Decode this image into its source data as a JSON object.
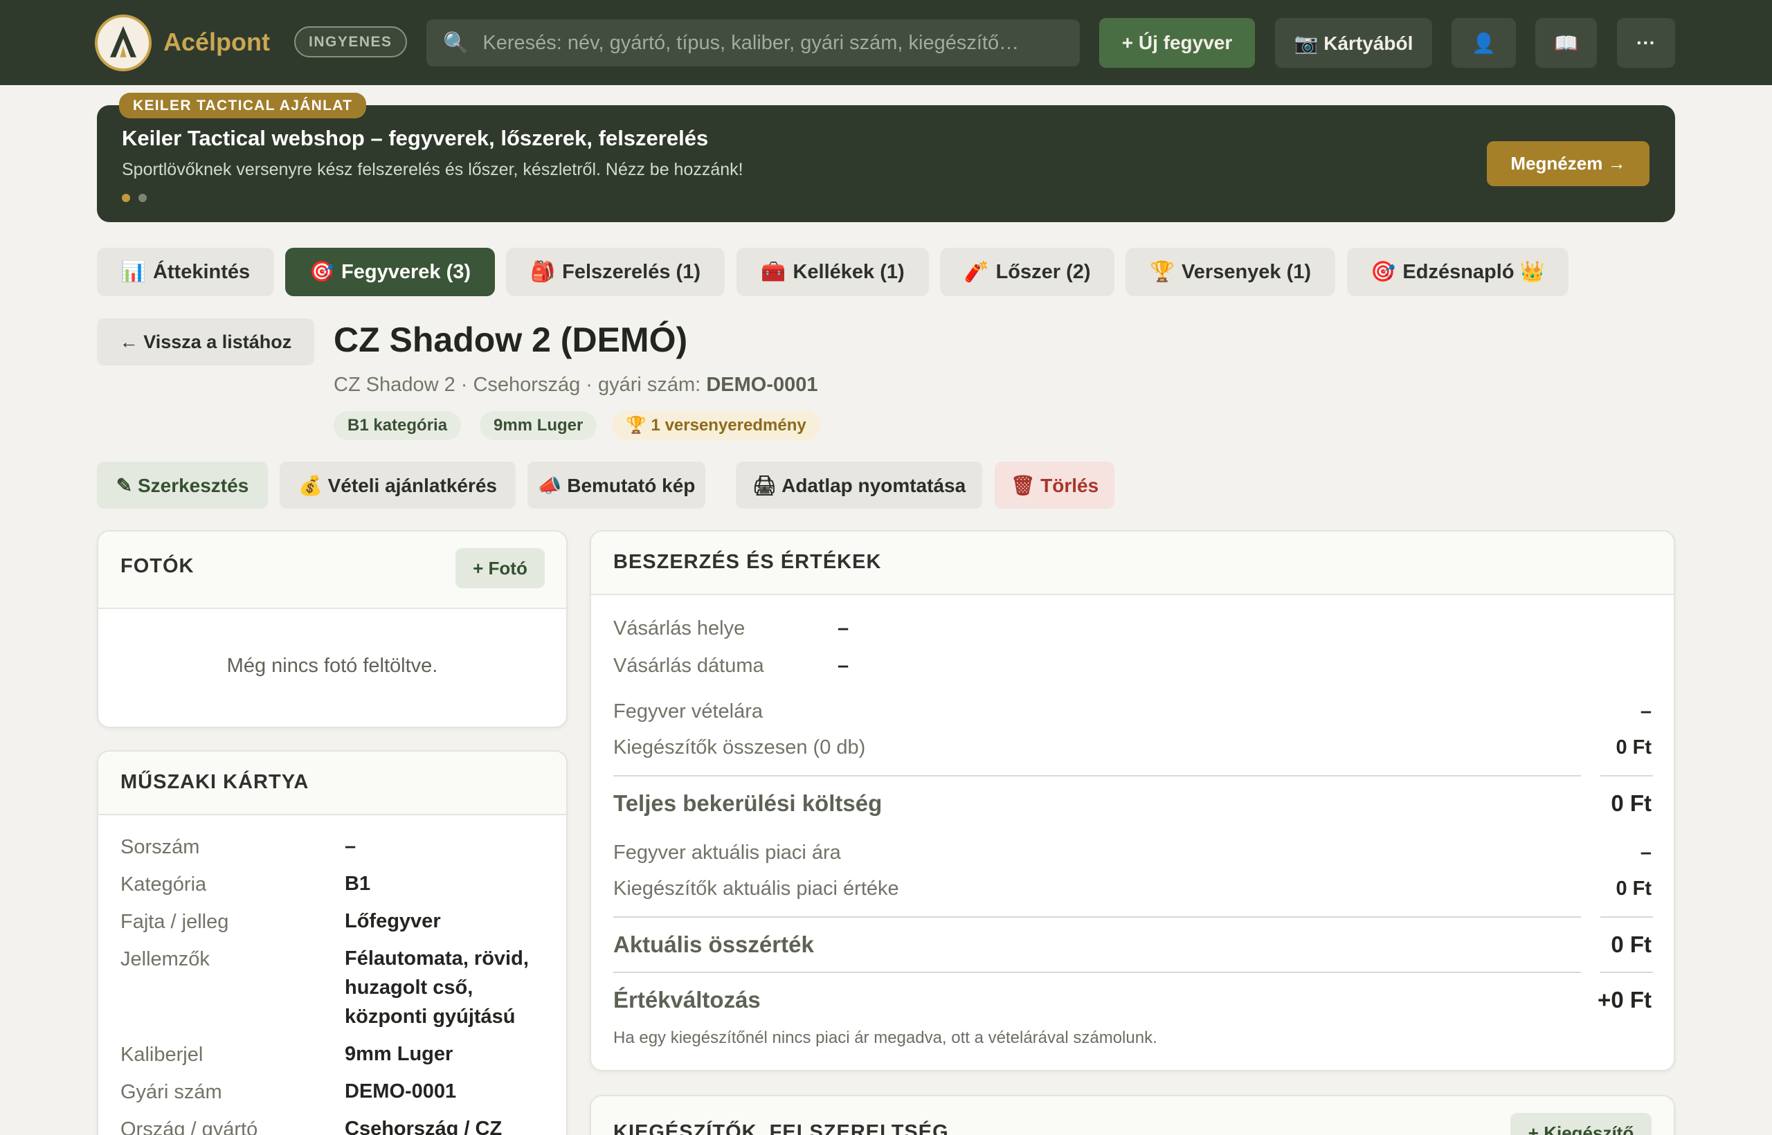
{
  "app": {
    "brand": "Acélpont",
    "plan_badge": "INGYENES",
    "search_placeholder": "Keresés: név, gyártó, típus, kaliber, gyári szám, kiegészítő…",
    "new_weapon": "+ Új fegyver",
    "from_card": "📷 Kártyából",
    "user_icon": "👤",
    "book_icon": "📖",
    "more_icon": "···"
  },
  "promo": {
    "tag": "KEILER TACTICAL AJÁNLAT",
    "title": "Keiler Tactical webshop – fegyverek, lőszerek, felszerelés",
    "subtitle": "Sportlövőknek versenyre kész felszerelés és lőszer, készletről. Nézz be hozzánk!",
    "cta": "Megnézem →"
  },
  "tabs": [
    {
      "icon": "📊",
      "label": "Áttekintés"
    },
    {
      "icon": "🎯",
      "label": "Fegyverek (3)"
    },
    {
      "icon": "🎒",
      "label": "Felszerelés (1)"
    },
    {
      "icon": "🧰",
      "label": "Kellékek (1)"
    },
    {
      "icon": "🧨",
      "label": "Lőszer (2)"
    },
    {
      "icon": "🏆",
      "label": "Versenyek (1)"
    },
    {
      "icon": "🎯",
      "label": "Edzésnapló 👑"
    }
  ],
  "detail": {
    "back": "← Vissza a listához",
    "title": "CZ Shadow 2 (DEMÓ)",
    "subtitle_prefix": "CZ Shadow 2 · Csehország · gyári szám: ",
    "serial": "DEMO-0001",
    "chips": [
      "B1 kategória",
      "9mm Luger",
      "🏆 1 versenyeredmény"
    ],
    "actions": {
      "edit": "✎ Szerkesztés",
      "offer": "💰 Vételi ajánlatkérés",
      "showcase": "📣 Bemutató kép",
      "print": "🖨 Adatlap nyomtatása",
      "delete": "🗑 Törlés"
    }
  },
  "photos": {
    "title": "FOTÓK",
    "add": "+ Fotó",
    "empty": "Még nincs fotó feltöltve."
  },
  "tech": {
    "title": "MŰSZAKI KÁRTYA",
    "rows": [
      {
        "label": "Sorszám",
        "value": "–"
      },
      {
        "label": "Kategória",
        "value": "B1"
      },
      {
        "label": "Fajta / jelleg",
        "value": "Lőfegyver"
      },
      {
        "label": "Jellemzők",
        "value": "Félautomata, rövid, huzagolt cső, központi gyújtású"
      },
      {
        "label": "Kaliberjel",
        "value": "9mm Luger"
      },
      {
        "label": "Gyári szám",
        "value": "DEMO-0001"
      },
      {
        "label": "Ország / gyártó",
        "value": "Csehország / CZ"
      }
    ]
  },
  "purchase": {
    "title": "BESZERZÉS ÉS ÉRTÉKEK",
    "place_label": "Vásárlás helye",
    "place_value": "–",
    "date_label": "Vásárlás dátuma",
    "date_value": "–",
    "price_label": "Fegyver vételára",
    "price_value": "–",
    "acc_total_label": "Kiegészítők összesen (0 db)",
    "acc_total_value": "0 Ft",
    "cost_label": "Teljes bekerülési költség",
    "cost_value": "0 Ft",
    "market_label": "Fegyver aktuális piaci ára",
    "market_value": "–",
    "acc_market_label": "Kiegészítők aktuális piaci értéke",
    "acc_market_value": "0 Ft",
    "current_label": "Aktuális összérték",
    "current_value": "0 Ft",
    "change_label": "Értékváltozás",
    "change_value": "+0 Ft",
    "note": "Ha egy kiegészítőnél nincs piaci ár megadva, ott a vételárával számolunk."
  },
  "accessories": {
    "title": "KIEGÉSZÍTŐK, FELSZERELTSÉG",
    "add": "+ Kiegészítő"
  },
  "colors": {
    "topbar": "#2f3a2c",
    "accent_green": "#3a5537",
    "gold": "#a58029"
  }
}
